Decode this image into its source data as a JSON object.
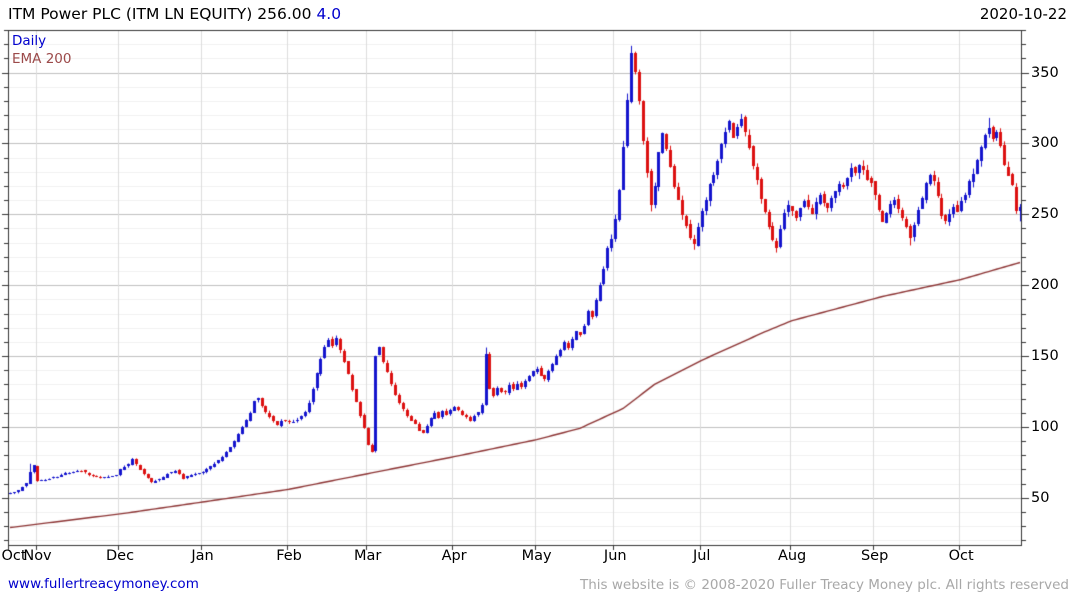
{
  "header": {
    "instrument": "ITM Power PLC (ITM LN EQUITY)",
    "last_price": "256.00",
    "change": "4.0",
    "date": "2020-10-22"
  },
  "legend": {
    "series_label": "Daily",
    "overlay_label": "EMA 200"
  },
  "footer": {
    "link": "www.fullertreacymoney.com",
    "copyright": "This website is © 2008-2020 Fuller Treacy Money plc. All rights reserved"
  },
  "colors": {
    "up_candle": "#1414cd",
    "down_candle": "#dc1010",
    "ema_line": "#8b3232",
    "ema_label": "#9c4a4a",
    "accent_blue": "#0000cd",
    "grid_minor": "#f0f0f0",
    "grid_major": "#bfbfbf",
    "grid_month": "#dcdcdc",
    "axis": "#333333",
    "copyright_gray": "#a8a8a8"
  },
  "chart_data": {
    "type": "candlestick",
    "title": "ITM Power PLC (ITM LN EQUITY) 256.00",
    "interval": "Daily",
    "overlay": "EMA 200",
    "as_of_date": "2020-10-22",
    "last_close": 256.0,
    "change": 4.0,
    "ylim": [
      16.7,
      380
    ],
    "y_major_step": 50,
    "y_minor_step": 10,
    "y_tick_labels": [
      350,
      300,
      250,
      200,
      150,
      100,
      50
    ],
    "total_days": 258,
    "months": [
      {
        "label": "Oct",
        "start_day": 0
      },
      {
        "label": "Nov",
        "start_day": 7
      },
      {
        "label": "Dec",
        "start_day": 28
      },
      {
        "label": "Jan",
        "start_day": 49
      },
      {
        "label": "Feb",
        "start_day": 71
      },
      {
        "label": "Mar",
        "start_day": 91
      },
      {
        "label": "Apr",
        "start_day": 113
      },
      {
        "label": "May",
        "start_day": 134
      },
      {
        "label": "Jun",
        "start_day": 154
      },
      {
        "label": "Jul",
        "start_day": 176
      },
      {
        "label": "Aug",
        "start_day": 199
      },
      {
        "label": "Sep",
        "start_day": 220
      },
      {
        "label": "Oct",
        "start_day": 242
      }
    ],
    "close_anchors": [
      [
        0,
        53
      ],
      [
        2,
        55
      ],
      [
        4,
        60
      ],
      [
        5,
        68
      ],
      [
        6,
        73
      ],
      [
        7,
        62
      ],
      [
        9,
        63
      ],
      [
        12,
        65
      ],
      [
        15,
        68
      ],
      [
        18,
        69
      ],
      [
        20,
        66
      ],
      [
        23,
        64
      ],
      [
        26,
        65
      ],
      [
        27,
        66
      ],
      [
        28,
        70
      ],
      [
        30,
        74
      ],
      [
        31,
        77
      ],
      [
        33,
        70
      ],
      [
        35,
        64
      ],
      [
        36,
        61
      ],
      [
        38,
        63
      ],
      [
        40,
        67
      ],
      [
        42,
        69
      ],
      [
        44,
        64
      ],
      [
        46,
        66
      ],
      [
        48,
        67
      ],
      [
        49,
        68
      ],
      [
        52,
        74
      ],
      [
        55,
        82
      ],
      [
        57,
        90
      ],
      [
        59,
        100
      ],
      [
        61,
        110
      ],
      [
        62,
        118
      ],
      [
        63,
        121
      ],
      [
        64,
        115
      ],
      [
        66,
        107
      ],
      [
        68,
        101
      ],
      [
        69,
        105
      ],
      [
        70,
        104
      ],
      [
        71,
        103
      ],
      [
        73,
        105
      ],
      [
        75,
        110
      ],
      [
        76,
        117
      ],
      [
        77,
        127
      ],
      [
        78,
        138
      ],
      [
        79,
        148
      ],
      [
        80,
        156
      ],
      [
        81,
        162
      ],
      [
        82,
        157
      ],
      [
        83,
        163
      ],
      [
        84,
        154
      ],
      [
        85,
        146
      ],
      [
        86,
        137
      ],
      [
        87,
        127
      ],
      [
        88,
        117
      ],
      [
        89,
        108
      ],
      [
        90,
        99
      ],
      [
        91,
        88
      ],
      [
        92,
        83
      ],
      [
        93,
        150
      ],
      [
        94,
        156
      ],
      [
        95,
        146
      ],
      [
        96,
        138
      ],
      [
        97,
        130
      ],
      [
        98,
        123
      ],
      [
        99,
        117
      ],
      [
        100,
        112
      ],
      [
        101,
        108
      ],
      [
        103,
        102
      ],
      [
        104,
        97
      ],
      [
        105,
        95
      ],
      [
        106,
        101
      ],
      [
        107,
        106
      ],
      [
        108,
        110
      ],
      [
        109,
        107
      ],
      [
        110,
        111
      ],
      [
        111,
        109
      ],
      [
        112,
        112
      ],
      [
        113,
        114
      ],
      [
        115,
        108
      ],
      [
        117,
        105
      ],
      [
        119,
        111
      ],
      [
        120,
        116
      ],
      [
        121,
        152
      ],
      [
        122,
        128
      ],
      [
        123,
        122
      ],
      [
        124,
        127
      ],
      [
        126,
        124
      ],
      [
        127,
        129
      ],
      [
        128,
        126
      ],
      [
        129,
        131
      ],
      [
        130,
        128
      ],
      [
        131,
        133
      ],
      [
        132,
        136
      ],
      [
        133,
        139
      ],
      [
        134,
        141
      ],
      [
        135,
        136
      ],
      [
        136,
        133
      ],
      [
        137,
        139
      ],
      [
        138,
        144
      ],
      [
        139,
        149
      ],
      [
        140,
        154
      ],
      [
        141,
        159
      ],
      [
        142,
        155
      ],
      [
        143,
        162
      ],
      [
        144,
        167
      ],
      [
        145,
        164
      ],
      [
        146,
        172
      ],
      [
        147,
        182
      ],
      [
        148,
        177
      ],
      [
        149,
        189
      ],
      [
        150,
        200
      ],
      [
        151,
        212
      ],
      [
        152,
        225
      ],
      [
        153,
        233
      ],
      [
        154,
        246
      ],
      [
        155,
        266
      ],
      [
        156,
        296
      ],
      [
        157,
        330
      ],
      [
        158,
        362
      ],
      [
        159,
        350
      ],
      [
        160,
        328
      ],
      [
        161,
        302
      ],
      [
        162,
        278
      ],
      [
        163,
        256
      ],
      [
        164,
        270
      ],
      [
        165,
        294
      ],
      [
        166,
        308
      ],
      [
        167,
        296
      ],
      [
        168,
        283
      ],
      [
        169,
        270
      ],
      [
        170,
        260
      ],
      [
        171,
        250
      ],
      [
        172,
        241
      ],
      [
        173,
        233
      ],
      [
        174,
        229
      ],
      [
        175,
        242
      ],
      [
        176,
        252
      ],
      [
        177,
        260
      ],
      [
        178,
        270
      ],
      [
        179,
        278
      ],
      [
        180,
        288
      ],
      [
        181,
        298
      ],
      [
        182,
        308
      ],
      [
        183,
        316
      ],
      [
        184,
        306
      ],
      [
        185,
        312
      ],
      [
        186,
        318
      ],
      [
        187,
        308
      ],
      [
        188,
        298
      ],
      [
        189,
        286
      ],
      [
        190,
        274
      ],
      [
        191,
        262
      ],
      [
        192,
        252
      ],
      [
        193,
        242
      ],
      [
        194,
        233
      ],
      [
        195,
        227
      ],
      [
        196,
        238
      ],
      [
        197,
        250
      ],
      [
        198,
        258
      ],
      [
        199,
        253
      ],
      [
        200,
        247
      ],
      [
        201,
        254
      ],
      [
        202,
        260
      ],
      [
        203,
        256
      ],
      [
        204,
        251
      ],
      [
        205,
        257
      ],
      [
        206,
        263
      ],
      [
        207,
        259
      ],
      [
        208,
        254
      ],
      [
        209,
        261
      ],
      [
        210,
        267
      ],
      [
        211,
        272
      ],
      [
        212,
        269
      ],
      [
        213,
        276
      ],
      [
        214,
        282
      ],
      [
        215,
        279
      ],
      [
        216,
        284
      ],
      [
        217,
        280
      ],
      [
        218,
        276
      ],
      [
        219,
        272
      ],
      [
        220,
        264
      ],
      [
        221,
        252
      ],
      [
        222,
        245
      ],
      [
        223,
        250
      ],
      [
        224,
        256
      ],
      [
        225,
        260
      ],
      [
        226,
        254
      ],
      [
        227,
        247
      ],
      [
        228,
        240
      ],
      [
        229,
        234
      ],
      [
        230,
        242
      ],
      [
        231,
        252
      ],
      [
        232,
        262
      ],
      [
        233,
        272
      ],
      [
        234,
        279
      ],
      [
        235,
        272
      ],
      [
        236,
        262
      ],
      [
        237,
        250
      ],
      [
        238,
        244
      ],
      [
        239,
        250
      ],
      [
        240,
        255
      ],
      [
        241,
        252
      ],
      [
        242,
        258
      ],
      [
        243,
        265
      ],
      [
        244,
        272
      ],
      [
        245,
        280
      ],
      [
        246,
        288
      ],
      [
        247,
        296
      ],
      [
        248,
        305
      ],
      [
        249,
        312
      ],
      [
        250,
        304
      ],
      [
        251,
        308
      ],
      [
        252,
        298
      ],
      [
        253,
        284
      ],
      [
        254,
        278
      ],
      [
        255,
        270
      ],
      [
        256,
        252
      ],
      [
        257,
        256
      ]
    ],
    "special_days": {
      "5": {
        "high": 74
      },
      "92": {
        "low": 82
      },
      "121": {
        "high": 156
      },
      "158": {
        "high": 368
      },
      "163": {
        "low": 252
      },
      "174": {
        "low": 225
      },
      "195": {
        "low": 223
      },
      "229": {
        "low": 228
      },
      "249": {
        "high": 318
      },
      "257": {
        "low": 245
      }
    },
    "ema_anchors": [
      [
        0,
        29
      ],
      [
        29,
        39
      ],
      [
        49,
        47
      ],
      [
        71,
        56
      ],
      [
        91,
        67
      ],
      [
        113,
        79
      ],
      [
        134,
        91
      ],
      [
        145,
        99
      ],
      [
        156,
        113
      ],
      [
        164,
        130
      ],
      [
        176,
        147
      ],
      [
        192,
        167
      ],
      [
        199,
        175
      ],
      [
        222,
        192
      ],
      [
        242,
        204
      ],
      [
        257,
        216
      ]
    ]
  }
}
